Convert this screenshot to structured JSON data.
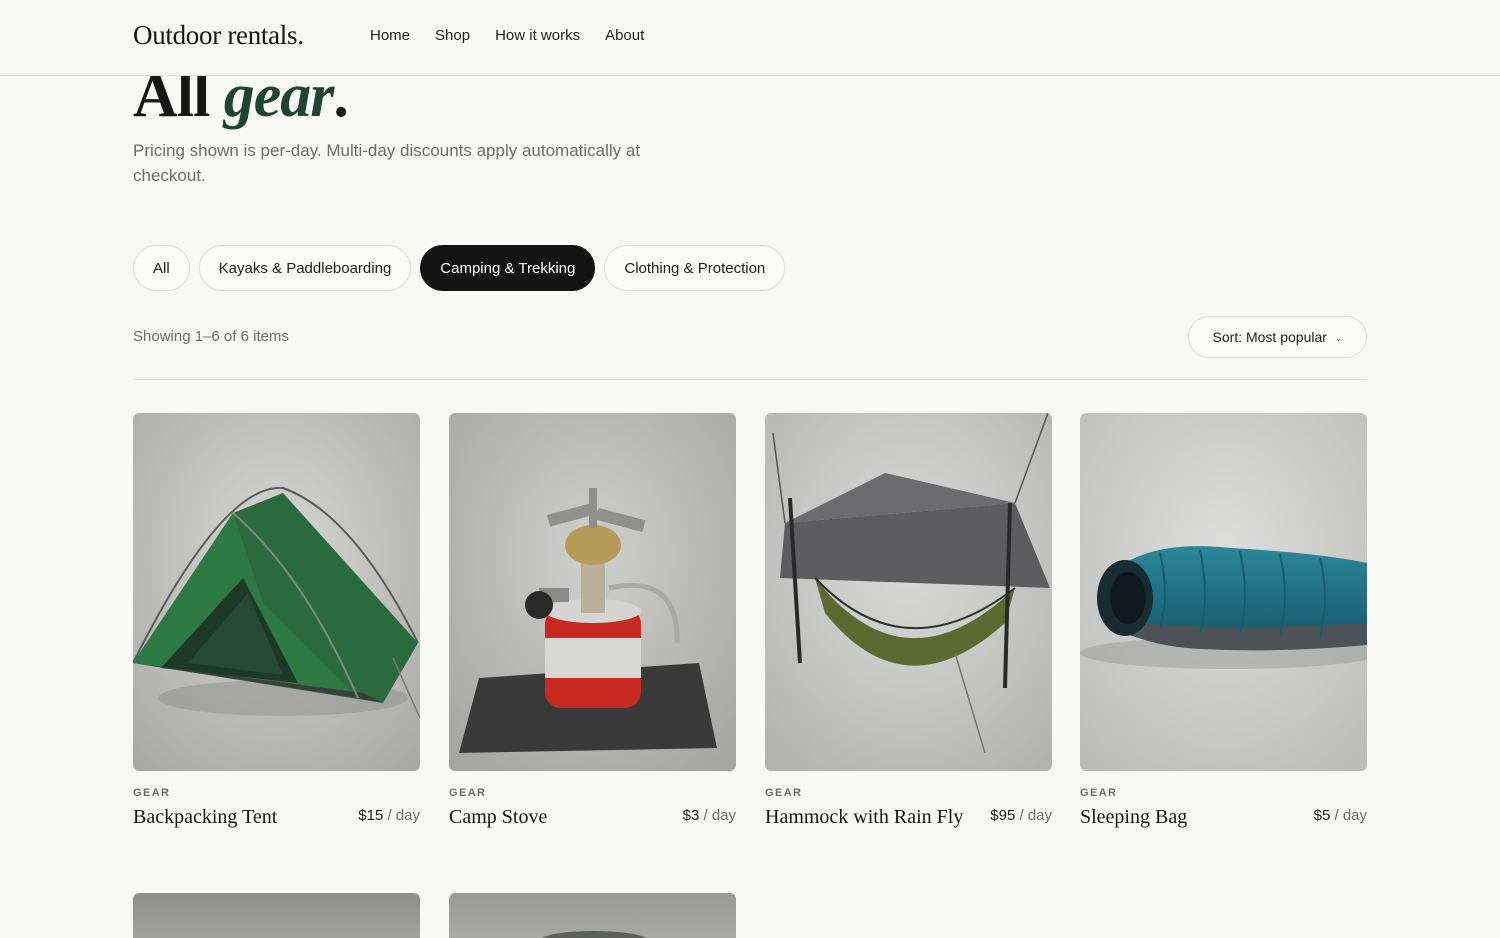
{
  "brand": {
    "logo_text": "Outdoor rentals."
  },
  "nav": {
    "items": [
      "Home",
      "Shop",
      "How it works",
      "About"
    ]
  },
  "hero": {
    "title_main": "All ",
    "title_accent": "gear",
    "title_end": ".",
    "description": "Pricing shown is per-day. Multi-day discounts apply automatically at checkout."
  },
  "filters": {
    "items": [
      "All",
      "Kayaks & Paddleboarding",
      "Camping & Trekking",
      "Clothing & Protection"
    ],
    "active": "Camping & Trekking"
  },
  "toolbar": {
    "showing": "Showing 1–6 of 6 items",
    "sort_label": "Sort: Most popular",
    "sort_icon": "chevron-down-icon"
  },
  "products": [
    {
      "category": "GEAR",
      "name": "Backpacking Tent",
      "price": "$15",
      "unit": " / day",
      "image": "green-dome-tent"
    },
    {
      "category": "GEAR",
      "name": "Camp Stove",
      "price": "$3",
      "unit": " / day",
      "image": "backpacking-stove-canister"
    },
    {
      "category": "GEAR",
      "name": "Hammock with Rain Fly",
      "price": "$95",
      "unit": " / day",
      "image": "olive-hammock-grey-tarp"
    },
    {
      "category": "GEAR",
      "name": "Sleeping Bag",
      "price": "$5",
      "unit": " / day",
      "image": "teal-mummy-sleeping-bag"
    }
  ],
  "colors": {
    "accent": "#1f4432",
    "active_pill": "#141414",
    "background": "#f8f8f6"
  }
}
